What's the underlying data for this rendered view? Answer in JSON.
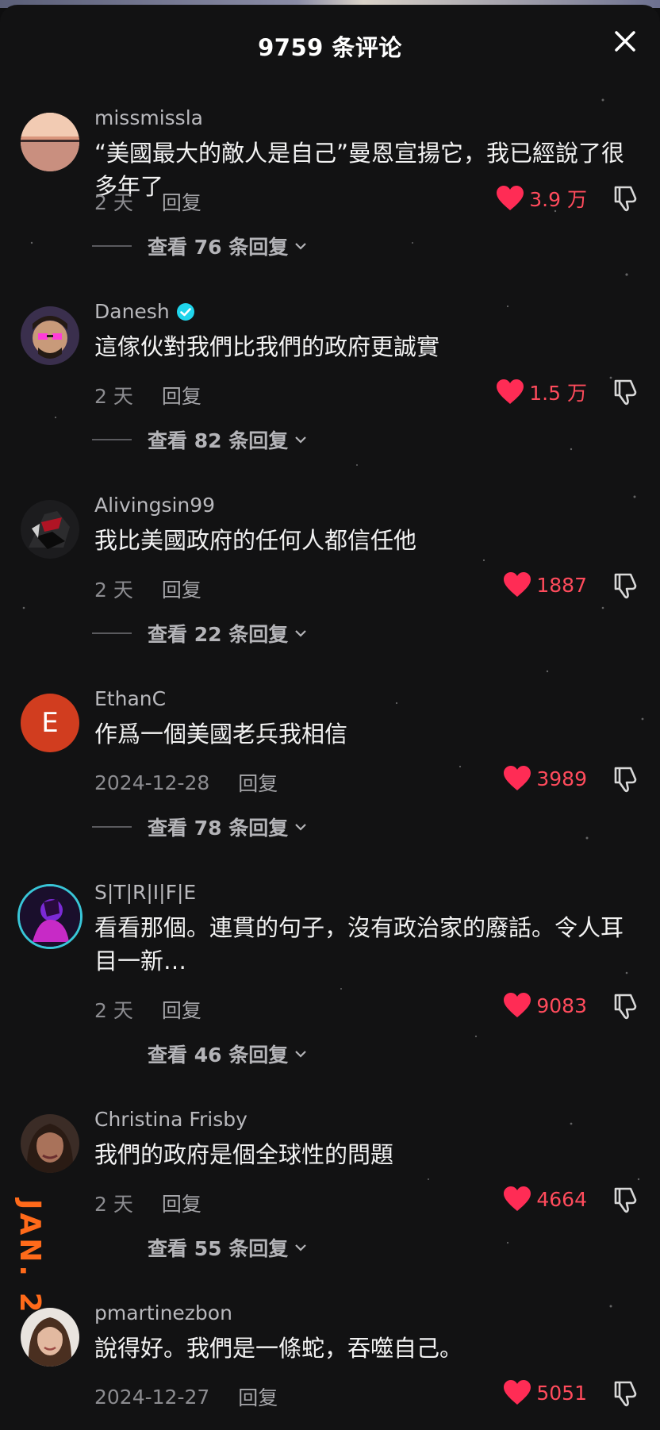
{
  "header": {
    "title": "9759 条评论",
    "close_icon": "close-icon"
  },
  "side_overlay": {
    "text": "JAN. 2"
  },
  "colors": {
    "like": "#ff4b5c",
    "verified": "#20d5ec",
    "date_overlay": "#ff6a1a"
  },
  "comments": [
    {
      "username": "missmissla",
      "text": "“美國最大的敵人是自己”曼恩宣揚它，我已經說了很多年了",
      "time": "2 天",
      "reply_label": "回复",
      "likes": "3.9 万",
      "view_replies": "查看 76 条回复",
      "avatar_icon": "sunset-avatar"
    },
    {
      "username": "Danesh",
      "verified": true,
      "text": "這傢伙對我們比我們的政府更誠實",
      "time": "2 天",
      "reply_label": "回复",
      "likes": "1.5 万",
      "view_replies": "查看 82 条回复",
      "avatar_icon": "pixel-face-avatar"
    },
    {
      "username": "Alivingsin99",
      "text": "我比美國政府的任何人都信任他",
      "time": "2 天",
      "reply_label": "回复",
      "likes": "1887",
      "view_replies": "查看 22 条回复",
      "avatar_icon": "hero-avatar"
    },
    {
      "username": "EthanC",
      "text": "作爲一個美國老兵我相信",
      "time": "2024-12-28",
      "reply_label": "回复",
      "likes": "3989",
      "view_replies": "查看 78 条回复",
      "avatar_letter": "E"
    },
    {
      "username": "S|T|R|I|F|E",
      "text": "看看那個。連貫的句子，沒有政治家的廢話。令人耳目一新…",
      "time": "2 天",
      "reply_label": "回复",
      "likes": "9083",
      "view_replies": "查看 46 条回复",
      "avatar_icon": "purple-figure-avatar"
    },
    {
      "username": "Christina Frisby",
      "text": "我們的政府是個全球性的問題",
      "time": "2 天",
      "reply_label": "回复",
      "likes": "4664",
      "view_replies": "查看 55 条回复",
      "avatar_icon": "woman-avatar"
    },
    {
      "username": "pmartinezbon",
      "text": "說得好。我們是一條蛇，吞噬自己。",
      "time": "2024-12-27",
      "reply_label": "回复",
      "likes": "5051",
      "avatar_icon": "woman-avatar-2"
    }
  ]
}
